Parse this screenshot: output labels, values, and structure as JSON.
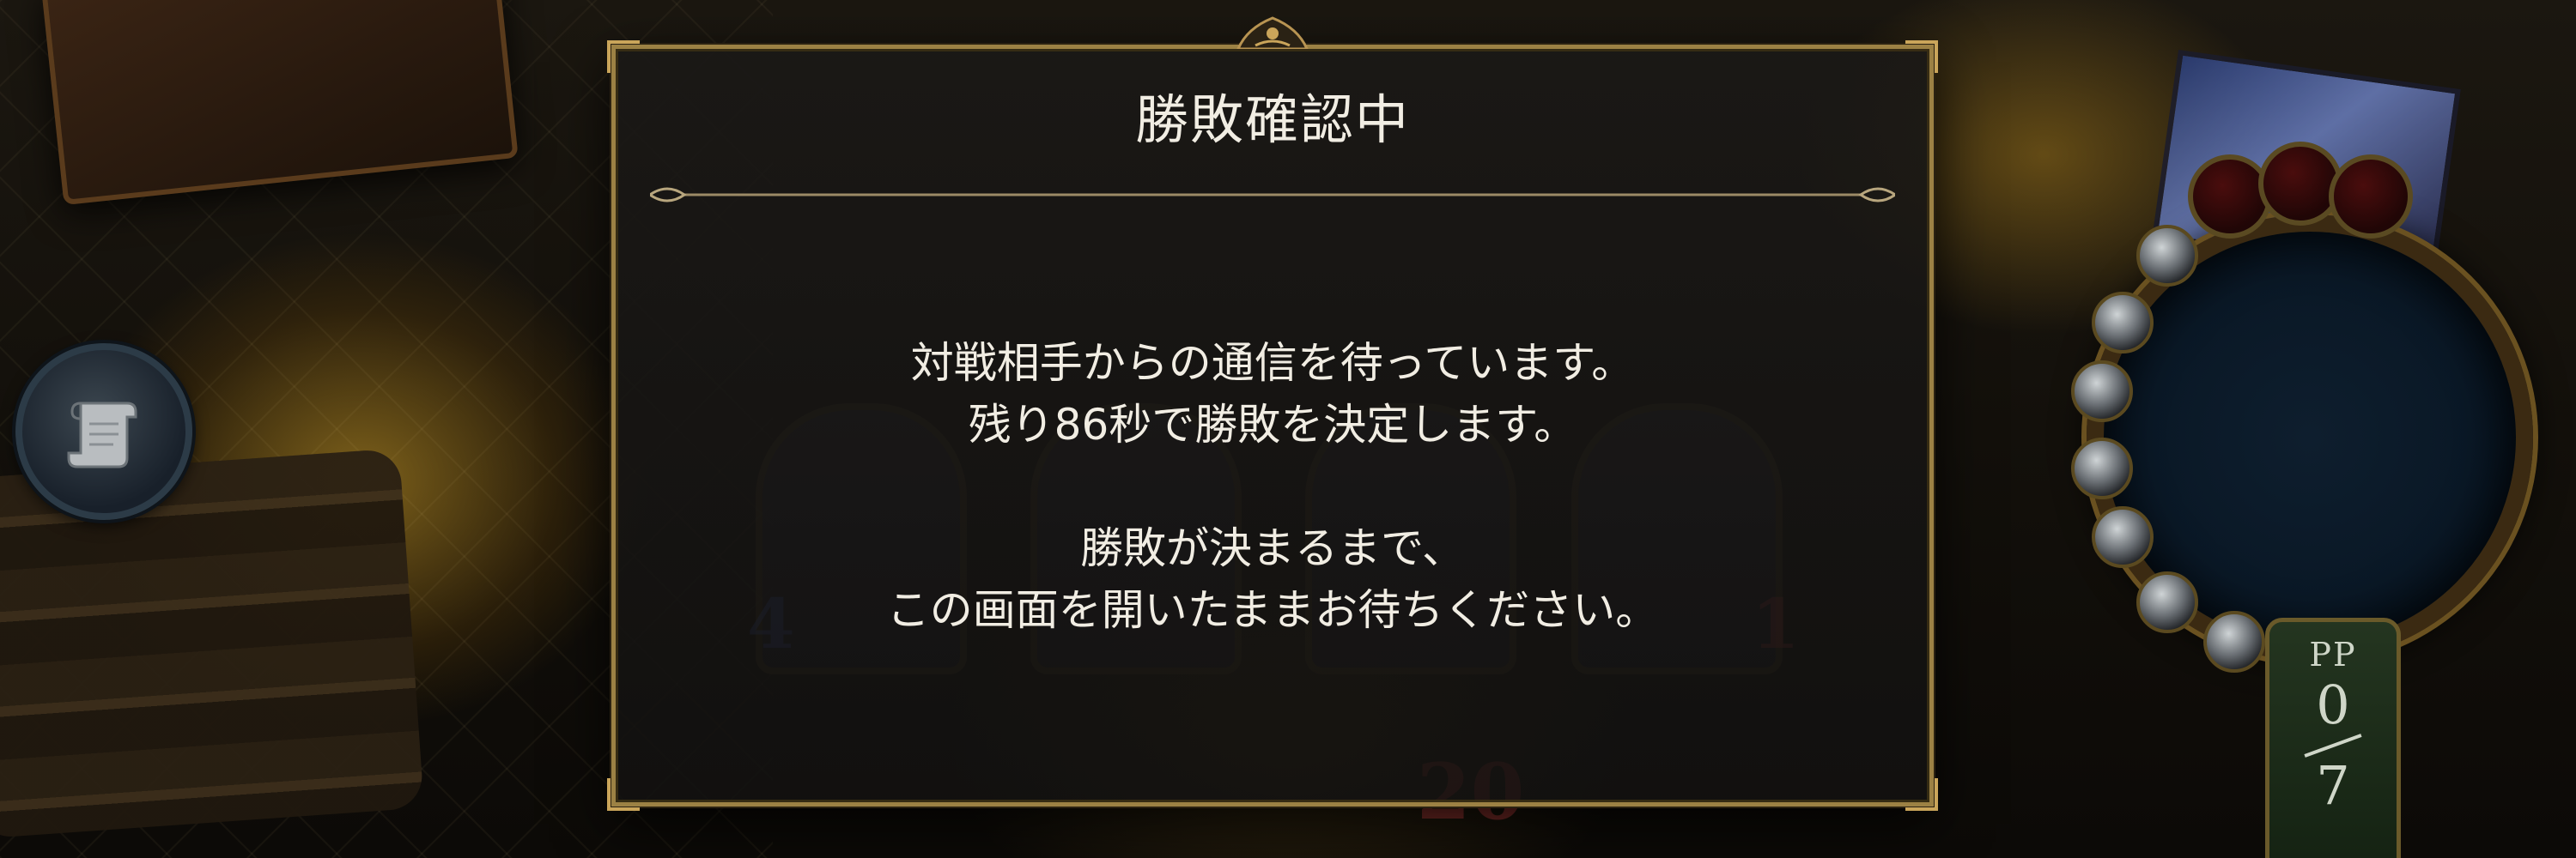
{
  "dialog": {
    "title": "勝敗確認中",
    "message_line1": "対戦相手からの通信を待っています。",
    "message_line2": "残り86秒で勝敗を決定します。",
    "message_line3": "勝敗が決まるまで、",
    "message_line4": "この画面を開いたままお待ちください。"
  },
  "board": {
    "pp_label": "PP",
    "pp_current": "0",
    "pp_max": "7",
    "leader_health": "20",
    "card_stat_left": "4",
    "card_stat_right": "1"
  },
  "icons": {
    "log_button": "scroll-icon"
  },
  "colors": {
    "dialog_border": "#9c8144",
    "dialog_text": "#f1ede3"
  }
}
